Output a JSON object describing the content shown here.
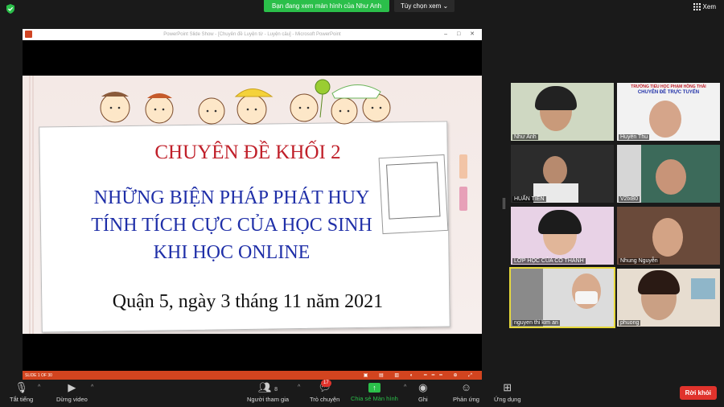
{
  "top": {
    "banner": "Bạn đang xem màn hình của Như Anh",
    "view_options": "Tùy chọn xem",
    "view_btn": "Xem"
  },
  "ppt": {
    "window_title": "PowerPoint Slide Show - [Chuyên đề Luyện từ - Luyện câu] - Microsoft PowerPoint",
    "slide_counter": "SLIDE 1 OF 30",
    "slide": {
      "title": "CHUYÊN ĐỀ KHỐI 2",
      "line1": "NHỮNG BIỆN PHÁP PHÁT HUY",
      "line2": "TÍNH TÍCH CỰC CỦA HỌC SINH",
      "line3": "KHI HỌC ONLINE",
      "date": "Quận 5, ngày 3 tháng 11 năm 2021"
    }
  },
  "gallery": {
    "participants": [
      {
        "name": "Như Anh"
      },
      {
        "name": "Huyền Thu",
        "banner1": "TRƯỜNG TIỂU HỌC PHẠM HỒNG THÁI",
        "banner2": "CHUYÊN ĐỀ TRỰC TUYẾN"
      },
      {
        "name": "HUẤN TIẾN"
      },
      {
        "name": "V2lxB0"
      },
      {
        "name": "LỚP HỌC CỦA CÔ THANH"
      },
      {
        "name": "Nhung Nguyễn"
      },
      {
        "name": "nguyen thi kim an"
      },
      {
        "name": "phuong"
      }
    ]
  },
  "toolbar": {
    "mute": "Tắt tiếng",
    "stop_video": "Dừng video",
    "participants": "Người tham gia",
    "participants_count": "8",
    "chat": "Trò chuyện",
    "chat_badge": "17",
    "share": "Chia sẻ Màn hình",
    "record": "Ghi",
    "reactions": "Phản ứng",
    "apps": "Ứng dụng",
    "leave": "Rời khỏi"
  },
  "colors": {
    "share_green": "#2bbf4a",
    "leave_red": "#e0332c",
    "title_red": "#c0202a",
    "subtitle_blue": "#1f2fa8",
    "ppt_status": "#d2441f"
  }
}
